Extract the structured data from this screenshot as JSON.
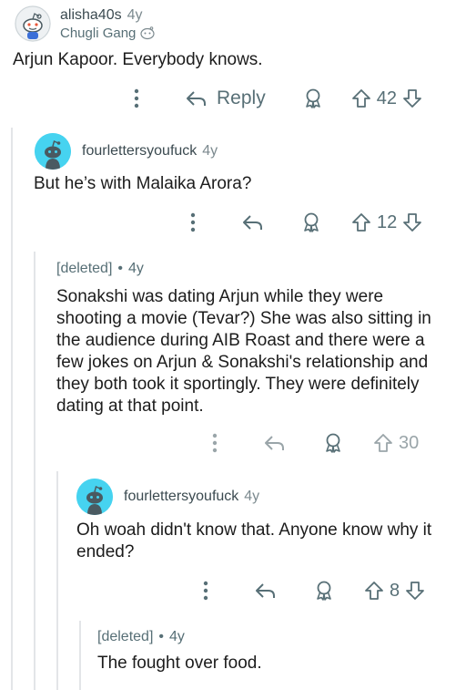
{
  "comments": [
    {
      "username": "alisha40s",
      "age": "4y",
      "flair": "Chugli Gang",
      "body": "Arjun Kapoor. Everybody knows.",
      "reply_label": "Reply",
      "score": "42"
    },
    {
      "username": "fourlettersyoufuck",
      "age": "4y",
      "body": "But he’s with Malaika Arora?",
      "score": "12"
    },
    {
      "username": "[deleted]",
      "separator": "•",
      "age": "4y",
      "body": "Sonakshi was dating Arjun while they were shooting a movie (Tevar?) She was also sitting in the audience during AIB Roast and there were a few jokes on Arjun & Sonakshi's relationship and they both took it sportingly. They were definitely dating at that point.",
      "score": "30"
    },
    {
      "username": "fourlettersyoufuck",
      "age": "4y",
      "body": "Oh woah didn't know that. Anyone know why it ended?",
      "score": "8"
    },
    {
      "username": "[deleted]",
      "separator": "•",
      "age": "4y",
      "body": "The fought over food."
    }
  ],
  "colors": {
    "avatar_bg": "#46d3f0",
    "text": "#1c1c1c",
    "muted": "#576f76",
    "thread_line": "#e3e5e8"
  },
  "icons": [
    "more-icon",
    "reply-icon",
    "award-icon",
    "upvote-icon",
    "downvote-icon"
  ]
}
